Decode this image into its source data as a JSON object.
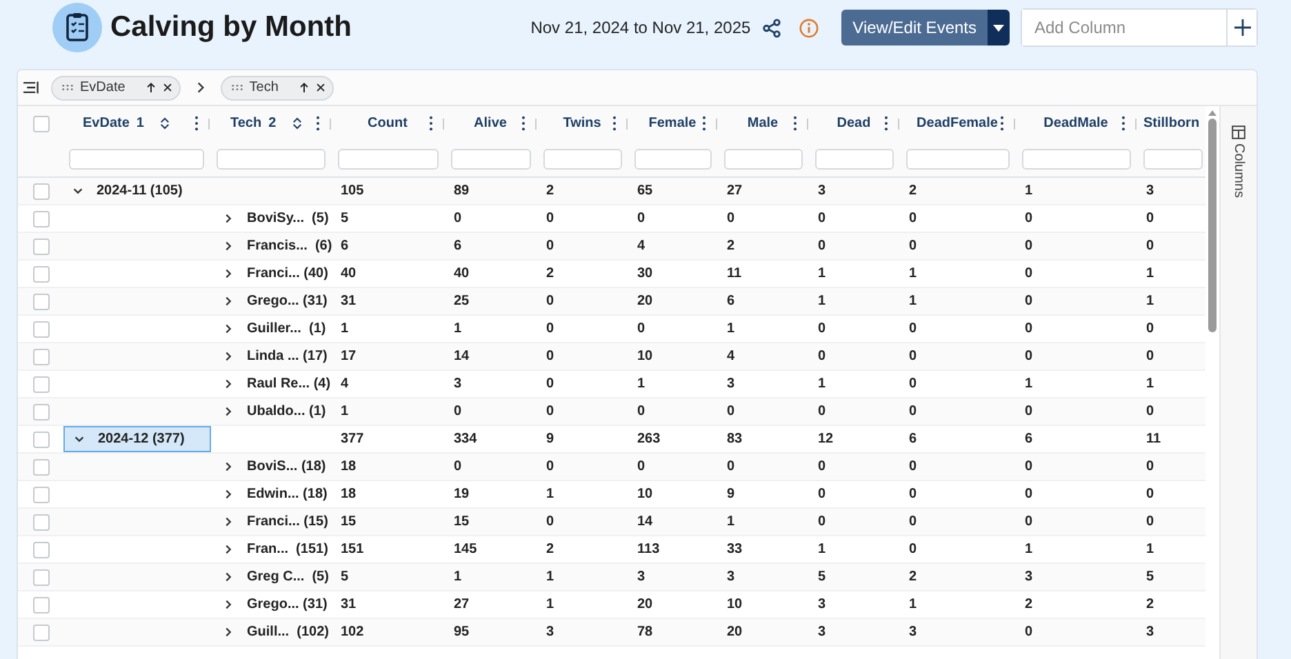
{
  "header": {
    "title": "Calving by Month",
    "date_range": "Nov 21, 2024 to Nov 21, 2025",
    "view_button": "View/Edit Events",
    "add_column": {
      "placeholder": "Add Column"
    }
  },
  "group_panel": {
    "chips": [
      {
        "label": "EvDate"
      },
      {
        "label": "Tech"
      }
    ]
  },
  "columns": [
    {
      "label": "EvDate",
      "sort_index": "1",
      "kind": "group"
    },
    {
      "label": "Tech",
      "sort_index": "2",
      "kind": "group"
    },
    {
      "label": "Count",
      "kind": "value"
    },
    {
      "label": "Alive",
      "kind": "value"
    },
    {
      "label": "Twins",
      "kind": "value"
    },
    {
      "label": "Female",
      "kind": "value"
    },
    {
      "label": "Male",
      "kind": "value"
    },
    {
      "label": "Dead",
      "kind": "value"
    },
    {
      "label": "DeadFemale",
      "kind": "value"
    },
    {
      "label": "DeadMale",
      "kind": "value"
    },
    {
      "label": "Stillborn",
      "kind": "value"
    }
  ],
  "side_panel": {
    "label": "Columns"
  },
  "select_all": {
    "checked": false
  },
  "rows": [
    {
      "kind": "group",
      "label": "2024-11 (105)",
      "expanded": true,
      "focused": false,
      "checked": false,
      "values": [
        "105",
        "89",
        "2",
        "65",
        "27",
        "3",
        "2",
        "1",
        "3"
      ]
    },
    {
      "kind": "child",
      "label": "BoviSy...  (5)",
      "expanded": false,
      "focused": false,
      "checked": false,
      "values": [
        "5",
        "0",
        "0",
        "0",
        "0",
        "0",
        "0",
        "0",
        "0"
      ]
    },
    {
      "kind": "child",
      "label": "Francis...  (6)",
      "expanded": false,
      "focused": false,
      "checked": false,
      "values": [
        "6",
        "6",
        "0",
        "4",
        "2",
        "0",
        "0",
        "0",
        "0"
      ]
    },
    {
      "kind": "child",
      "label": "Franci... (40)",
      "expanded": false,
      "focused": false,
      "checked": false,
      "values": [
        "40",
        "40",
        "2",
        "30",
        "11",
        "1",
        "1",
        "0",
        "1"
      ]
    },
    {
      "kind": "child",
      "label": "Grego... (31)",
      "expanded": false,
      "focused": false,
      "checked": false,
      "values": [
        "31",
        "25",
        "0",
        "20",
        "6",
        "1",
        "1",
        "0",
        "1"
      ]
    },
    {
      "kind": "child",
      "label": "Guiller...  (1)",
      "expanded": false,
      "focused": false,
      "checked": false,
      "values": [
        "1",
        "1",
        "0",
        "0",
        "1",
        "0",
        "0",
        "0",
        "0"
      ]
    },
    {
      "kind": "child",
      "label": "Linda ... (17)",
      "expanded": false,
      "focused": false,
      "checked": false,
      "values": [
        "17",
        "14",
        "0",
        "10",
        "4",
        "0",
        "0",
        "0",
        "0"
      ]
    },
    {
      "kind": "child",
      "label": "Raul Re... (4)",
      "expanded": false,
      "focused": false,
      "checked": false,
      "values": [
        "4",
        "3",
        "0",
        "1",
        "3",
        "1",
        "0",
        "1",
        "1"
      ]
    },
    {
      "kind": "child",
      "label": "Ubaldo... (1)",
      "expanded": false,
      "focused": false,
      "checked": false,
      "values": [
        "1",
        "0",
        "0",
        "0",
        "0",
        "0",
        "0",
        "0",
        "0"
      ]
    },
    {
      "kind": "group",
      "label": "2024-12 (377)",
      "expanded": true,
      "focused": true,
      "checked": false,
      "values": [
        "377",
        "334",
        "9",
        "263",
        "83",
        "12",
        "6",
        "6",
        "11"
      ]
    },
    {
      "kind": "child",
      "label": "BoviS... (18)",
      "expanded": false,
      "focused": false,
      "checked": false,
      "values": [
        "18",
        "0",
        "0",
        "0",
        "0",
        "0",
        "0",
        "0",
        "0"
      ]
    },
    {
      "kind": "child",
      "label": "Edwin... (18)",
      "expanded": false,
      "focused": false,
      "checked": false,
      "values": [
        "18",
        "19",
        "1",
        "10",
        "9",
        "0",
        "0",
        "0",
        "0"
      ]
    },
    {
      "kind": "child",
      "label": "Franci... (15)",
      "expanded": false,
      "focused": false,
      "checked": false,
      "values": [
        "15",
        "15",
        "0",
        "14",
        "1",
        "0",
        "0",
        "0",
        "0"
      ]
    },
    {
      "kind": "child",
      "label": "Fran...  (151)",
      "expanded": false,
      "focused": false,
      "checked": false,
      "values": [
        "151",
        "145",
        "2",
        "113",
        "33",
        "1",
        "0",
        "1",
        "1"
      ]
    },
    {
      "kind": "child",
      "label": "Greg C...  (5)",
      "expanded": false,
      "focused": false,
      "checked": false,
      "values": [
        "5",
        "1",
        "1",
        "3",
        "3",
        "5",
        "2",
        "3",
        "5"
      ]
    },
    {
      "kind": "child",
      "label": "Grego... (31)",
      "expanded": false,
      "focused": false,
      "checked": false,
      "values": [
        "31",
        "27",
        "1",
        "20",
        "10",
        "3",
        "1",
        "2",
        "2"
      ]
    },
    {
      "kind": "child",
      "label": "Guill...  (102)",
      "expanded": false,
      "focused": false,
      "checked": false,
      "values": [
        "102",
        "95",
        "3",
        "78",
        "20",
        "3",
        "3",
        "0",
        "3"
      ]
    }
  ]
}
